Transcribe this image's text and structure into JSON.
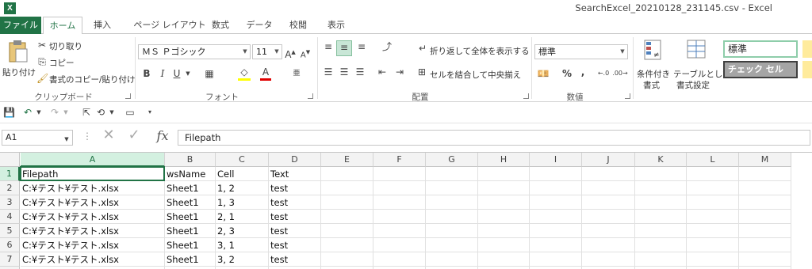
{
  "window": {
    "title": "SearchExcel_20210128_231145.csv - Excel"
  },
  "tabs": [
    "ファイル",
    "ホーム",
    "挿入",
    "ページ レイアウト",
    "数式",
    "データ",
    "校閲",
    "表示"
  ],
  "ribbon": {
    "clipboard": {
      "paste": "貼り付け",
      "cut": "切り取り",
      "copy": "コピー",
      "format_painter": "書式のコピー/貼り付け",
      "label": "クリップボード"
    },
    "font": {
      "name": "ＭＳ Ｐゴシック",
      "size": "11",
      "bold": "B",
      "italic": "I",
      "underline": "U",
      "label": "フォント"
    },
    "alignment": {
      "wrap": "折り返して全体を表示する",
      "merge": "セルを結合して中央揃え",
      "label": "配置"
    },
    "number": {
      "format": "標準",
      "percent": "%",
      "comma": ",",
      "label": "数値"
    },
    "styles": {
      "conditional": [
        "条件付き",
        "書式"
      ],
      "table": [
        "テーブルとして",
        "書式設定"
      ],
      "style_normal": "標準",
      "style_check": "チェック セル"
    }
  },
  "formula_bar": {
    "name_box": "A1",
    "fx": "fx",
    "content": "Filepath"
  },
  "grid": {
    "columns": [
      "A",
      "B",
      "C",
      "D",
      "E",
      "F",
      "G",
      "H",
      "I",
      "J",
      "K",
      "L",
      "M"
    ],
    "rows": [
      "1",
      "2",
      "3",
      "4",
      "5",
      "6",
      "7",
      "8"
    ],
    "cells": [
      [
        "Filepath",
        "wsName",
        "Cell",
        "Text"
      ],
      [
        "C:¥テスト¥テスト.xlsx",
        "Sheet1",
        "1, 2",
        "test"
      ],
      [
        "C:¥テスト¥テスト.xlsx",
        "Sheet1",
        "1, 3",
        "test"
      ],
      [
        "C:¥テスト¥テスト.xlsx",
        "Sheet1",
        "2, 1",
        "test"
      ],
      [
        "C:¥テスト¥テスト.xlsx",
        "Sheet1",
        "2, 3",
        "test"
      ],
      [
        "C:¥テスト¥テスト.xlsx",
        "Sheet1",
        "3, 1",
        "test"
      ],
      [
        "C:¥テスト¥テスト.xlsx",
        "Sheet1",
        "3, 2",
        "test"
      ]
    ]
  },
  "colors": {
    "accent": "#217346",
    "selected_header": "#d3f0e0"
  }
}
